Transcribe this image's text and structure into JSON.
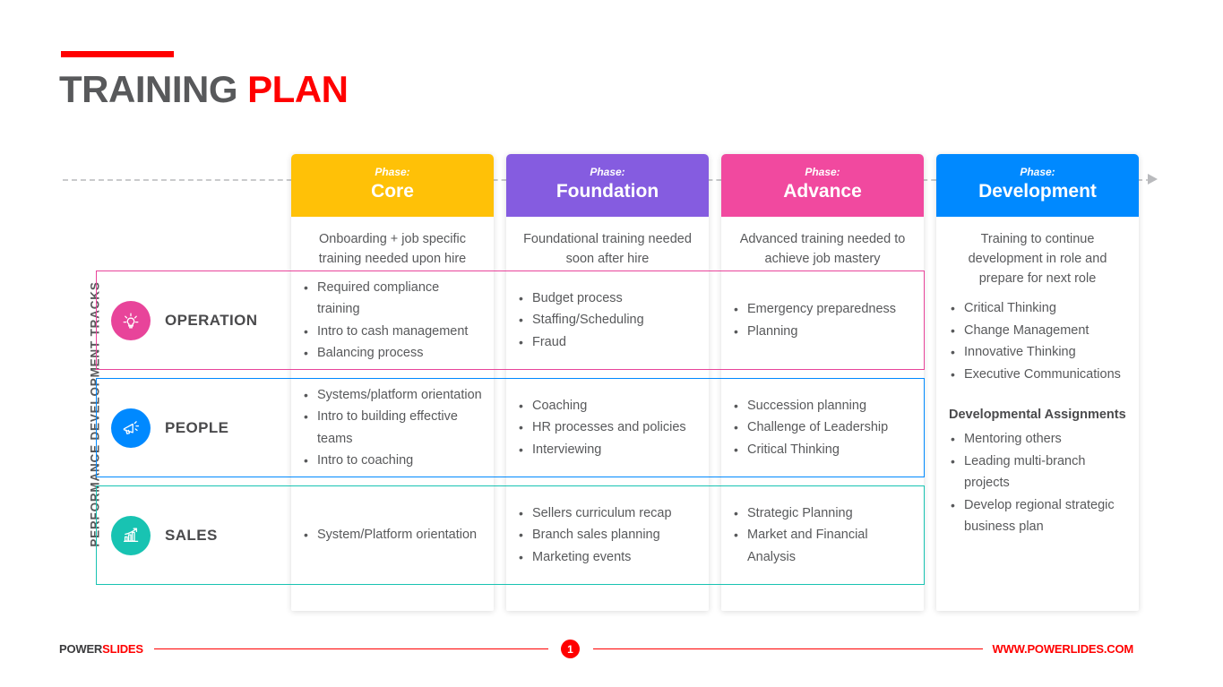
{
  "title": {
    "part1": "TRAINING ",
    "part2": "PLAN"
  },
  "axis": {
    "label": "PERFORMANCE DEVELOPMENT TRACKS"
  },
  "phases": [
    {
      "kicker": "Phase:",
      "name": "Core",
      "description": "Onboarding + job specific training needed upon hire",
      "color": "#FFC107"
    },
    {
      "kicker": "Phase:",
      "name": "Foundation",
      "description": "Foundational training needed soon after hire",
      "color": "#855CE0"
    },
    {
      "kicker": "Phase:",
      "name": "Advance",
      "description": "Advanced training needed to achieve job mastery",
      "color": "#F1499F"
    },
    {
      "kicker": "Phase:",
      "name": "Development",
      "description": "Training to continue development in role and prepare for next role",
      "color": "#0089FF"
    }
  ],
  "tracks": [
    {
      "name": "OPERATION",
      "icon": "lightbulb-icon",
      "color": "#E8449A",
      "core": [
        "Required compliance training",
        "Intro to cash management",
        "Balancing process"
      ],
      "foundation": [
        "Budget process",
        "Staffing/Scheduling",
        "Fraud"
      ],
      "advance": [
        "Emergency preparedness",
        "Planning"
      ]
    },
    {
      "name": "PEOPLE",
      "icon": "megaphone-icon",
      "color": "#0089FF",
      "core": [
        "Systems/platform orientation",
        "Intro to building effective teams",
        "Intro to coaching"
      ],
      "foundation": [
        "Coaching",
        "HR processes and policies",
        "Interviewing"
      ],
      "advance": [
        "Succession planning",
        "Challenge of Leadership",
        "Critical Thinking"
      ]
    },
    {
      "name": "SALES",
      "icon": "growth-chart-icon",
      "color": "#18C3B2",
      "core": [
        "System/Platform orientation"
      ],
      "foundation": [
        "Sellers curriculum recap",
        "Branch sales planning",
        "Marketing events"
      ],
      "advance": [
        "Strategic Planning",
        "Market and Financial Analysis"
      ]
    }
  ],
  "development": {
    "skills": [
      "Critical Thinking",
      "Change Management",
      "Innovative Thinking",
      "Executive Communications"
    ],
    "assignments_title": "Developmental Assignments",
    "assignments": [
      "Mentoring others",
      "Leading multi-branch projects",
      "Develop regional strategic business plan"
    ]
  },
  "footer": {
    "logo_part1": "POWER",
    "logo_part2": "SLIDES",
    "page_number": "1",
    "url": "WWW.POWERLIDES.COM"
  }
}
